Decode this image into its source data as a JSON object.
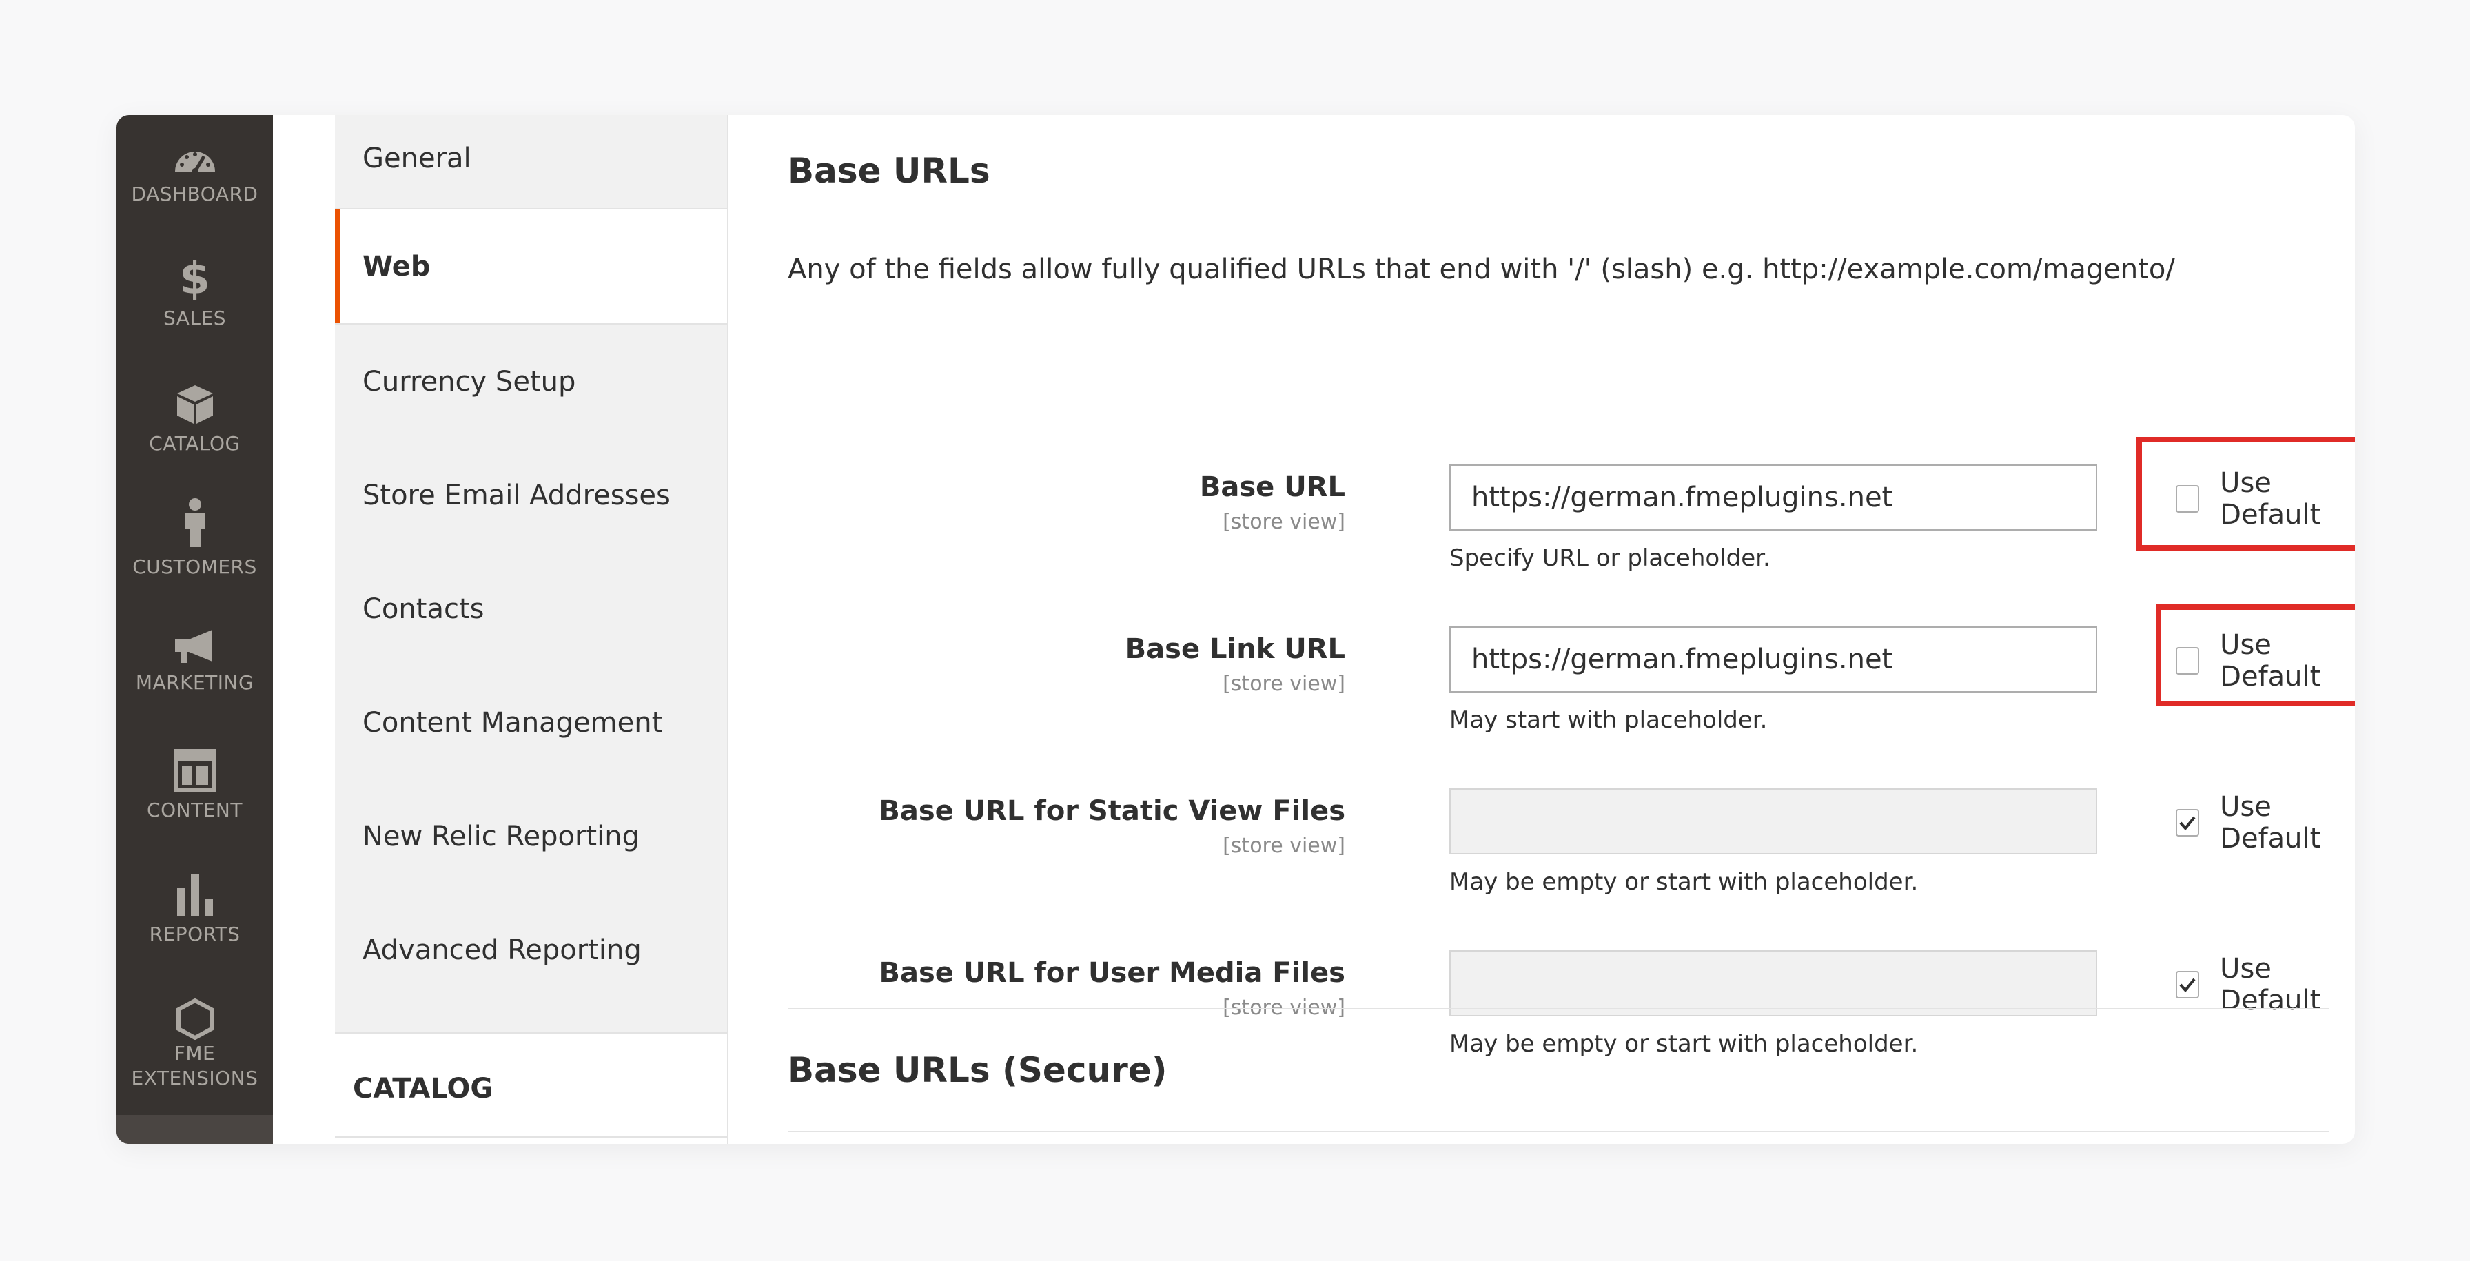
{
  "adminbar": {
    "items": [
      {
        "label": "DASHBOARD",
        "icon": "dashboard-icon"
      },
      {
        "label": "SALES",
        "icon": "dollar-icon"
      },
      {
        "label": "CATALOG",
        "icon": "box-icon"
      },
      {
        "label": "CUSTOMERS",
        "icon": "person-icon"
      },
      {
        "label": "MARKETING",
        "icon": "megaphone-icon"
      },
      {
        "label": "CONTENT",
        "icon": "layout-icon"
      },
      {
        "label": "REPORTS",
        "icon": "bar-chart-icon"
      },
      {
        "label": "FME\nEXTENSIONS",
        "label_line1": "FME",
        "label_line2": "EXTENSIONS",
        "icon": "hexagon-icon"
      }
    ]
  },
  "tabs": {
    "items": [
      {
        "label": "General"
      },
      {
        "label": "Web",
        "active": true
      },
      {
        "label": "Currency Setup"
      },
      {
        "label": "Store Email Addresses"
      },
      {
        "label": "Contacts"
      },
      {
        "label": "Content Management"
      },
      {
        "label": "New Relic Reporting"
      },
      {
        "label": "Advanced Reporting"
      }
    ],
    "group_heading": "CATALOG"
  },
  "section": {
    "title": "Base URLs",
    "intro": "Any of the fields allow fully qualified URLs that end with '/' (slash) e.g. http://example.com/magento/",
    "fields": [
      {
        "label": "Base URL",
        "scope": "[store view]",
        "value": "https://german.fmeplugins.net",
        "note": "Specify URL or placeholder.",
        "use_default_label": "Use Default",
        "use_default_checked": false,
        "highlighted": true
      },
      {
        "label": "Base Link URL",
        "scope": "[store view]",
        "value": "https://german.fmeplugins.net",
        "note": "May start with placeholder.",
        "use_default_label": "Use Default",
        "use_default_checked": false,
        "highlighted": true
      },
      {
        "label": "Base URL for Static View Files",
        "scope": "[store view]",
        "value": "",
        "note": "May be empty or start with placeholder.",
        "use_default_label": "Use Default",
        "use_default_checked": true,
        "highlighted": false
      },
      {
        "label": "Base URL for User Media Files",
        "scope": "[store view]",
        "value": "",
        "note": "May be empty or start with placeholder.",
        "use_default_label": "Use Default",
        "use_default_checked": true,
        "highlighted": false
      }
    ]
  },
  "section2": {
    "title": "Base URLs (Secure)"
  },
  "colors": {
    "accent": "#eb5202",
    "highlight": "#e02b27",
    "adminbar_bg": "#373330",
    "adminbar_text": "#aaa6a0"
  }
}
